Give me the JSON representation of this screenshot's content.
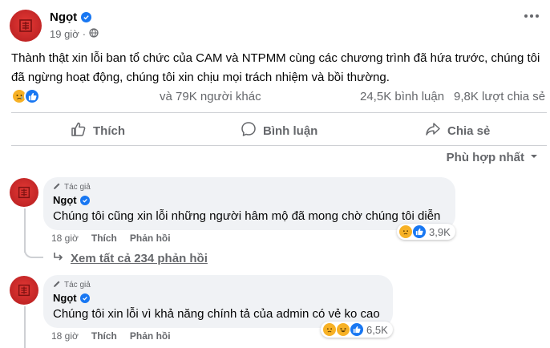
{
  "post": {
    "author": "Ngọt",
    "time": "19 giờ",
    "text": "Thành thật xin lỗi ban tổ chức của CAM và NTPMM cùng các chương trình đã hứa trước, chúng tôi đã ngừng hoạt động, chúng tôi xin chịu mọi trách nhiệm và bồi thường.",
    "reactions_others": "và 79K người khác",
    "comments_count": "24,5K bình luận",
    "shares_count": "9,8K lượt chia sẻ"
  },
  "actions": {
    "like": "Thích",
    "comment": "Bình luận",
    "share": "Chia sẻ"
  },
  "sort_label": "Phù hợp nhất",
  "comments": [
    {
      "badge": "Tác giả",
      "name": "Ngọt",
      "text": "Chúng tôi cũng xin lỗi những người hâm mộ đã mong chờ chúng tôi diễn",
      "time": "18 giờ",
      "like": "Thích",
      "reply": "Phản hồi",
      "reactions": "3,9K"
    },
    {
      "badge": "Tác giả",
      "name": "Ngọt",
      "text": "Chúng tôi xin lỗi vì khả năng chính tả của admin có vẻ ko cao",
      "time": "18 giờ",
      "like": "Thích",
      "reply": "Phản hồi",
      "reactions": "6,5K"
    }
  ],
  "see_replies": "Xem tất cả 234 phản hồi",
  "colors": {
    "accent": "#1877f2",
    "avatar_red": "#c62828",
    "secondary_text": "#65676b",
    "bubble": "#f0f2f5"
  }
}
